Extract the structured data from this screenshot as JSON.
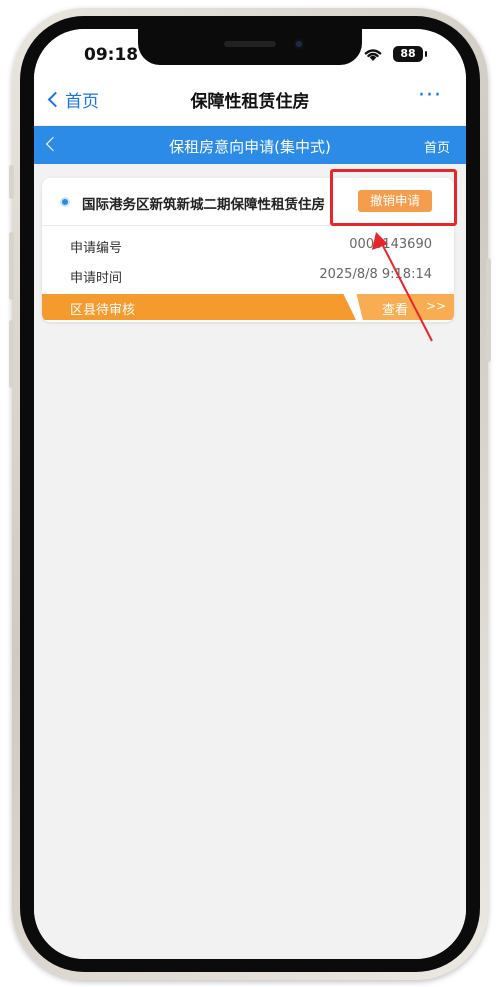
{
  "status_bar": {
    "time": "09:18",
    "battery": "88"
  },
  "nav_bar": {
    "back_label": "首页",
    "title": "保障性租赁住房",
    "more": "···"
  },
  "page_header": {
    "back": "<",
    "title": "保租房意向申请(集中式)",
    "home": "首页"
  },
  "application_card": {
    "title": "国际港务区新筑新城二期保障性租赁住房",
    "cancel_button": "撤销申请",
    "fields": [
      {
        "label": "申请编号",
        "value": "0000143690"
      },
      {
        "label": "申请时间",
        "value": "2025/8/8 9:18:14"
      }
    ],
    "status": "区县待审核",
    "view_label": "查看",
    "view_arrows": ">>"
  },
  "colors": {
    "accent_blue": "#2b8be6",
    "status_orange": "#f59a2d",
    "button_orange": "#f59d4c",
    "highlight_red": "#e8252a"
  }
}
